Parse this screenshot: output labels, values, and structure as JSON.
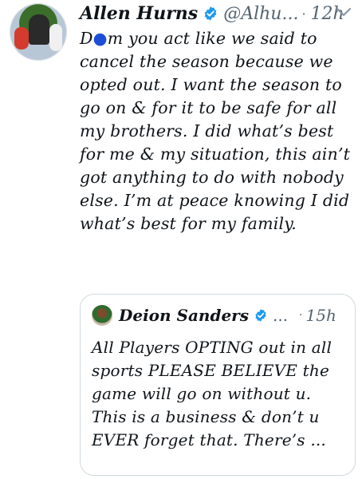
{
  "tweet": {
    "author_name": "Allen Hurns",
    "handle": "@Alhu...",
    "separator": "·",
    "time": "12h",
    "body_prefix": "D",
    "body_censor": "●",
    "body_rest": "m you act like we said to cancel the season because we opted out. I want the season to go on & for it to be safe for all my brothers. I did what’s best for me & my situation, this ain’t got anything to do with nobody else. I’m at peace knowing I did what’s best for my family."
  },
  "quoted_tweet": {
    "author_name": "Deion Sanders",
    "handle": "...",
    "separator": "·",
    "time": "15h",
    "body": "All Players OPTING out in all sports PLEASE BELIEVE the game will go on without u. This is a business & don’t u EVER forget that. There’s ..."
  },
  "icons": {
    "verified": "verified-badge-icon",
    "more": "chevron-down-icon"
  },
  "colors": {
    "verified": "#1d9bf0",
    "text": "#0f1419",
    "muted": "#536471",
    "border": "#cfd9de"
  }
}
